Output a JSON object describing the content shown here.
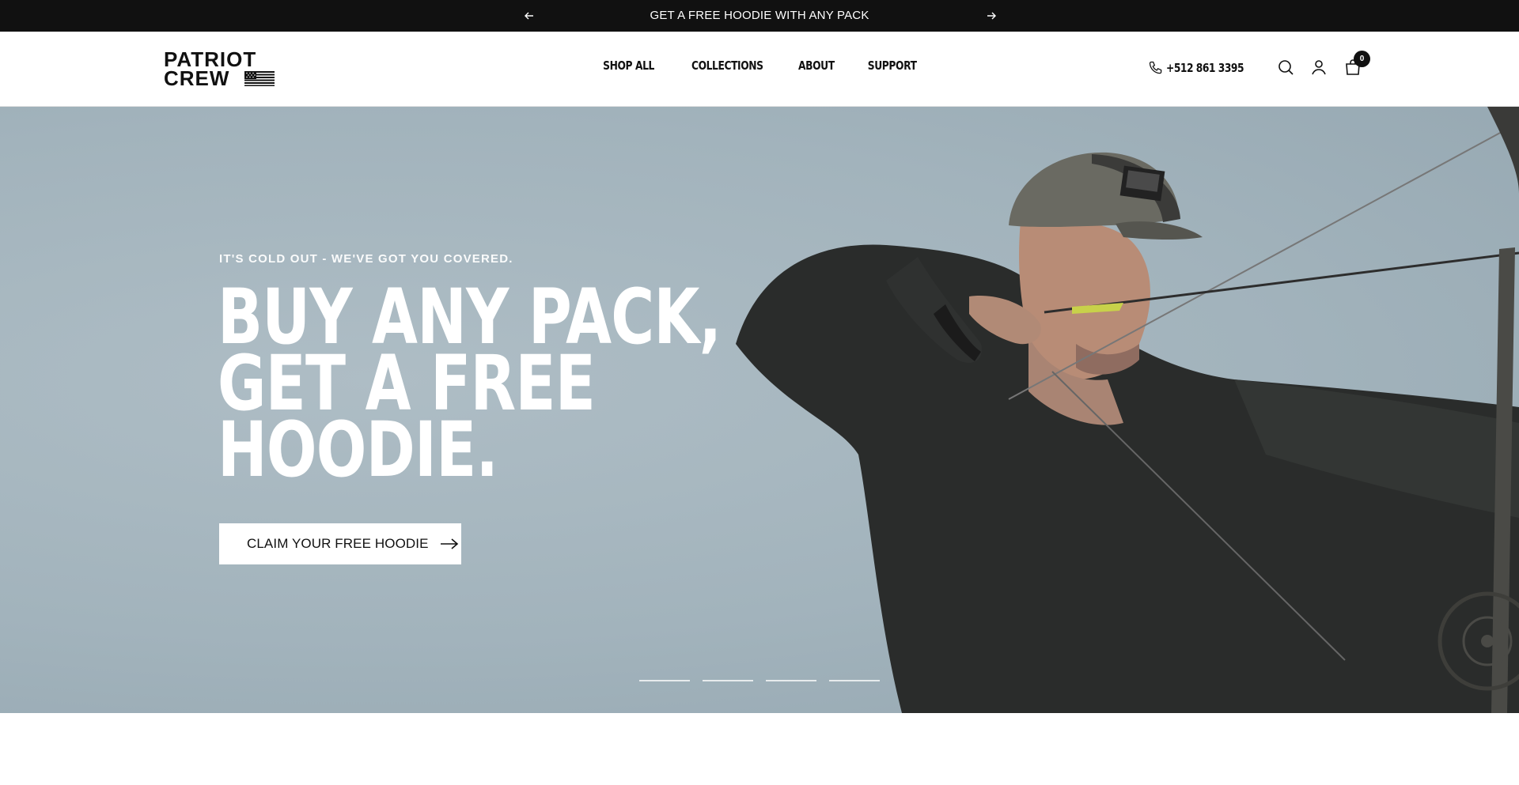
{
  "announcement": {
    "text": "GET A FREE HOODIE WITH ANY PACK",
    "prev_icon": "arrow-left-icon",
    "next_icon": "arrow-right-icon"
  },
  "header": {
    "logo": {
      "line1": "PATRIOT",
      "line2": "CREW"
    },
    "nav": [
      {
        "label": "SHOP ALL"
      },
      {
        "label": "COLLECTIONS"
      },
      {
        "label": "ABOUT"
      },
      {
        "label": "SUPPORT"
      }
    ],
    "phone": "+512 861 3395",
    "cart_count": "0",
    "icons": [
      "phone-icon",
      "search-icon",
      "account-icon",
      "cart-icon"
    ]
  },
  "hero": {
    "eyebrow": "IT'S COLD OUT - WE'VE GOT YOU COVERED.",
    "title_lines": [
      "BUY ANY PACK,",
      "GET A FREE",
      "HOODIE."
    ],
    "cta_label": "CLAIM YOUR FREE HOODIE",
    "slides": 4,
    "active_slide": 1
  },
  "colors": {
    "announcement_bg": "#111111",
    "hero_sky": "#a2b3bc",
    "text_dark": "#111111",
    "text_light": "#ffffff"
  }
}
